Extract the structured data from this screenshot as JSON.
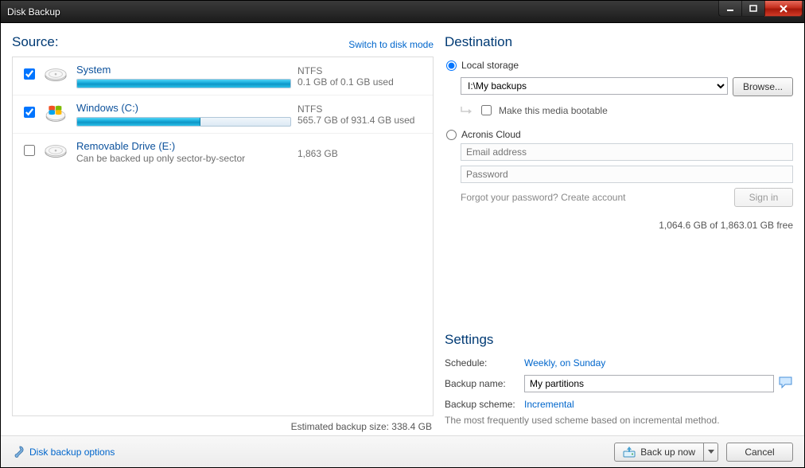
{
  "window": {
    "title": "Disk Backup"
  },
  "source_section": {
    "title": "Source:",
    "switch_mode": "Switch to disk mode"
  },
  "drives": [
    {
      "checked": true,
      "icon": "hdd",
      "name": "System",
      "fs": "NTFS",
      "usage": "0.1 GB of 0.1 GB used",
      "progress_pct": 100,
      "note": ""
    },
    {
      "checked": true,
      "icon": "win-hdd",
      "name": "Windows (C:)",
      "fs": "NTFS",
      "usage": "565.7 GB of 931.4 GB used",
      "progress_pct": 58,
      "note": ""
    },
    {
      "checked": false,
      "icon": "hdd",
      "name": "Removable Drive (E:)",
      "fs": "",
      "usage": "1,863 GB",
      "progress_pct": null,
      "note": "Can be backed up only sector-by-sector"
    }
  ],
  "estimated": "Estimated backup size: 338.4 GB",
  "destination": {
    "title": "Destination",
    "local_label": "Local storage",
    "cloud_label": "Acronis Cloud",
    "selected": "local",
    "path_value": "I:\\My backups",
    "browse": "Browse...",
    "bootable": "Make this media bootable",
    "email_ph": "Email address",
    "password_ph": "Password",
    "forgot": "Forgot your password?",
    "create": "Create account",
    "signin": "Sign in",
    "free_space": "1,064.6 GB of 1,863.01 GB free"
  },
  "settings": {
    "title": "Settings",
    "schedule_label": "Schedule:",
    "schedule_value": "Weekly, on Sunday",
    "name_label": "Backup name:",
    "name_value": "My partitions",
    "scheme_label": "Backup scheme:",
    "scheme_value": "Incremental",
    "scheme_desc": "The most frequently used scheme based on incremental method."
  },
  "bottom": {
    "options": "Disk backup options",
    "back_up_now": "Back up now",
    "cancel": "Cancel"
  }
}
